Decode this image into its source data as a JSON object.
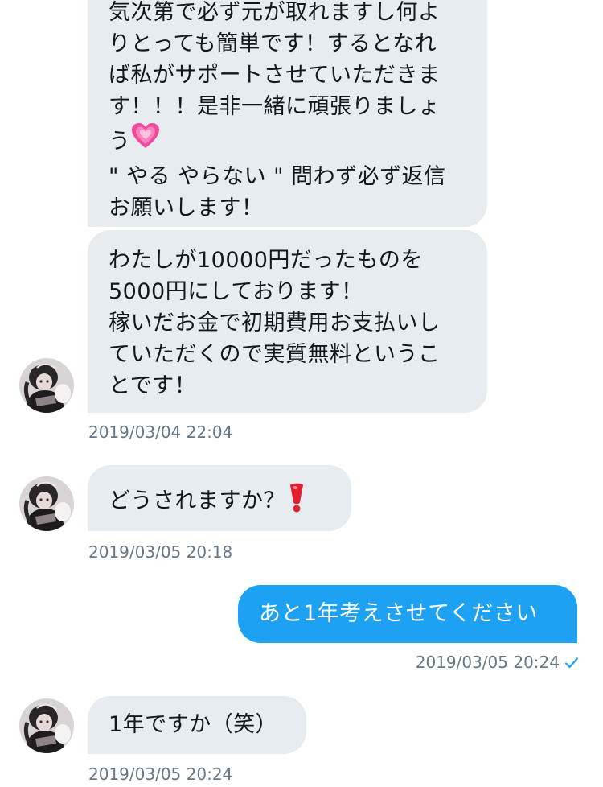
{
  "conversation": {
    "messages": [
      {
        "direction": "received",
        "lines": [
          "気次第で必ず元が取れますし何よ",
          "りとっても簡単です！するとなれ",
          "ば私がサポートさせていただきま",
          "す！！！是非一緒に頑張りましょ",
          "う",
          "\" やる やらない \" 問わず必ず返信",
          "お願いします！"
        ],
        "emoji": "growing-heart"
      },
      {
        "direction": "received",
        "lines": [
          "わたしが10000円だったものを",
          "5000円にしております！",
          "稼いだお金で初期費用お支払いし",
          "ていただくので実質無料というこ",
          "とです！"
        ],
        "timestamp": "2019/03/04 22:04"
      },
      {
        "direction": "received",
        "text": "どうされますか？",
        "emoji": "heavy-exclamation-mark",
        "timestamp": "2019/03/05 20:18"
      },
      {
        "direction": "sent",
        "text": "あと1年考えさせてください",
        "timestamp": "2019/03/05 20:24",
        "read_receipt": "check-icon"
      },
      {
        "direction": "received",
        "text": "1年ですか（笑）",
        "timestamp": "2019/03/05 20:24"
      }
    ]
  },
  "colors": {
    "received_bubble": "#e6ecf0",
    "sent_bubble": "#1da1f2",
    "timestamp_text": "#657786",
    "checkmark": "#1da1f2"
  }
}
